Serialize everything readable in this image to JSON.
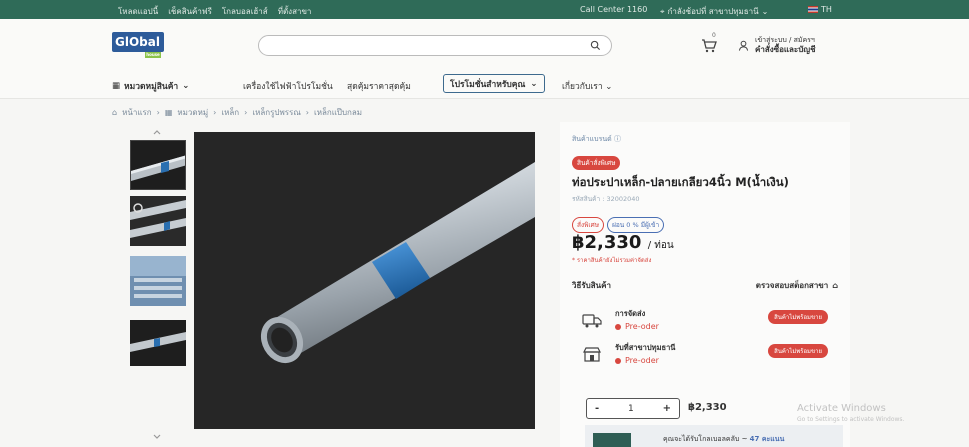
{
  "topbar": {
    "links": [
      "โหลดแอปนี้",
      "เช็คสินค้าฟรี",
      "โกลบอลเฮ้าส์",
      "ที่ตั้งสาขา"
    ],
    "call_center": "Call Center 1160",
    "branch_label": "กำลังช้อปที่ สาขาปทุมธานี",
    "language": "TH"
  },
  "header": {
    "logo_text": "GlObal",
    "logo_sub": "house",
    "search": {
      "value": "",
      "placeholder": ""
    },
    "cart_count": "0",
    "account": {
      "line1": "เข้าสู่ระบบ / สมัครฯ",
      "line2": "คำสั่งซื้อและบัญชี"
    }
  },
  "nav": {
    "categories": "หมวดหมู่สินค้า",
    "item1": "เครื่องใช้ไฟฟ้าโปรโมชั่น",
    "item2": "สุดคุ้มราคาสุดคุ้ม",
    "promo_pill": "โปรโมชั่นสำหรับคุณ",
    "about": "เกี่ยวกับเรา"
  },
  "breadcrumb": [
    "หน้าแรก",
    "หมวดหมู่",
    "เหล็ก",
    "เหล็กรูปพรรณ",
    "เหล็กแป๊บกลม"
  ],
  "product": {
    "brand_link": "สินค้าแบรนด์ ⓘ",
    "tag": "สินค้าสั่งพิเศษ",
    "title": "ท่อประปาเหล็ก-ปลายเกลียว4นิ้ว M(น้ำเงิน)",
    "sku": "รหัสสินค้า : 32002040",
    "chip_special": "สั่งพิเศษ",
    "chip_installment": "ผ่อน 0 % มีผู้เข้า",
    "price": "฿2,330",
    "price_unit": "/ ท่อน",
    "price_note": "* ราคาสินค้ายังไม่รวมค่าจัดส่ง",
    "receive_title": "วิธีรับสินค้า",
    "check_store": "ตรวจสอบสต็อกสาขา"
  },
  "delivery": [
    {
      "label": "การจัดส่ง",
      "status": "Pre-oder",
      "button": "สินค้าไม่พร้อมขาย",
      "icon": "truck-icon"
    },
    {
      "label": "รับที่สาขาปทุมธานี",
      "status": "Pre-oder",
      "button": "สินค้าไม่พร้อมขาย",
      "icon": "store-icon"
    }
  ],
  "cart": {
    "minus": "-",
    "qty": "1",
    "plus": "+",
    "subtotal": "฿2,330"
  },
  "promo": {
    "text": "คุณจะได้รับโกลเบอลคลับ ~ ",
    "points": "47 คะแนน"
  },
  "windows_activation": {
    "title": "Activate Windows",
    "sub": "Go to Settings to activate Windows."
  },
  "colors": {
    "topbar": "#2f6b58",
    "accent_red": "#d8473f",
    "brand_blue": "#2d5b9a"
  }
}
